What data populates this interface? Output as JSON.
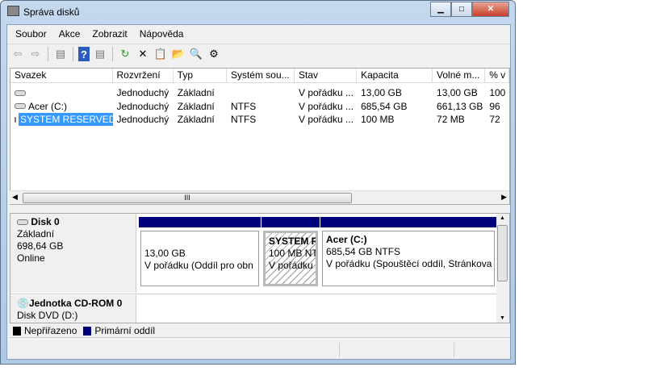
{
  "window": {
    "title": "Správa disků"
  },
  "menu": [
    "Soubor",
    "Akce",
    "Zobrazit",
    "Nápověda"
  ],
  "toolbar": [
    "back-icon",
    "forward-icon",
    "show-hide-console-tree-icon",
    "help-icon",
    "show-hide-action-pane-icon",
    "refresh-icon",
    "delete-icon",
    "properties-icon",
    "open-icon",
    "explore-icon",
    "settings-icon"
  ],
  "list": {
    "columns": [
      "Svazek",
      "Rozvržení",
      "Typ",
      "Systém sou...",
      "Stav",
      "Kapacita",
      "Volné m...",
      "% v"
    ],
    "rows": [
      [
        "",
        "Jednoduchý",
        "Základní",
        "",
        "V pořádku ...",
        "13,00 GB",
        "13,00 GB",
        "100"
      ],
      [
        "Acer (C:)",
        "Jednoduchý",
        "Základní",
        "NTFS",
        "V pořádku ...",
        "685,54 GB",
        "661,13 GB",
        "96"
      ],
      [
        "SYSTEM RESERVED",
        "Jednoduchý",
        "Základní",
        "NTFS",
        "V pořádku ...",
        "100 MB",
        "72 MB",
        "72"
      ]
    ],
    "selected_row": 2,
    "hscroll_grip": "III"
  },
  "disks": [
    {
      "name": "Disk 0",
      "type": "Základní",
      "size": "698,64 GB",
      "status": "Online",
      "partitions": [
        {
          "title": "",
          "size": "13,00 GB",
          "status": "V pořádku (Oddíl pro obn"
        },
        {
          "title": "SYSTEM RI",
          "size": "100 MB NT",
          "status": "V pořádku"
        },
        {
          "title": "Acer  (C:)",
          "size": "685,54 GB NTFS",
          "status": "V pořádku (Spouštěcí oddíl, Stránkova"
        }
      ]
    },
    {
      "name": "Jednotka CD-ROM 0",
      "type": "Disk DVD (D:)"
    }
  ],
  "legend": [
    {
      "label": "Nepřiřazeno",
      "color": "#000000"
    },
    {
      "label": "Primární oddíl",
      "color": "#00007b"
    }
  ]
}
